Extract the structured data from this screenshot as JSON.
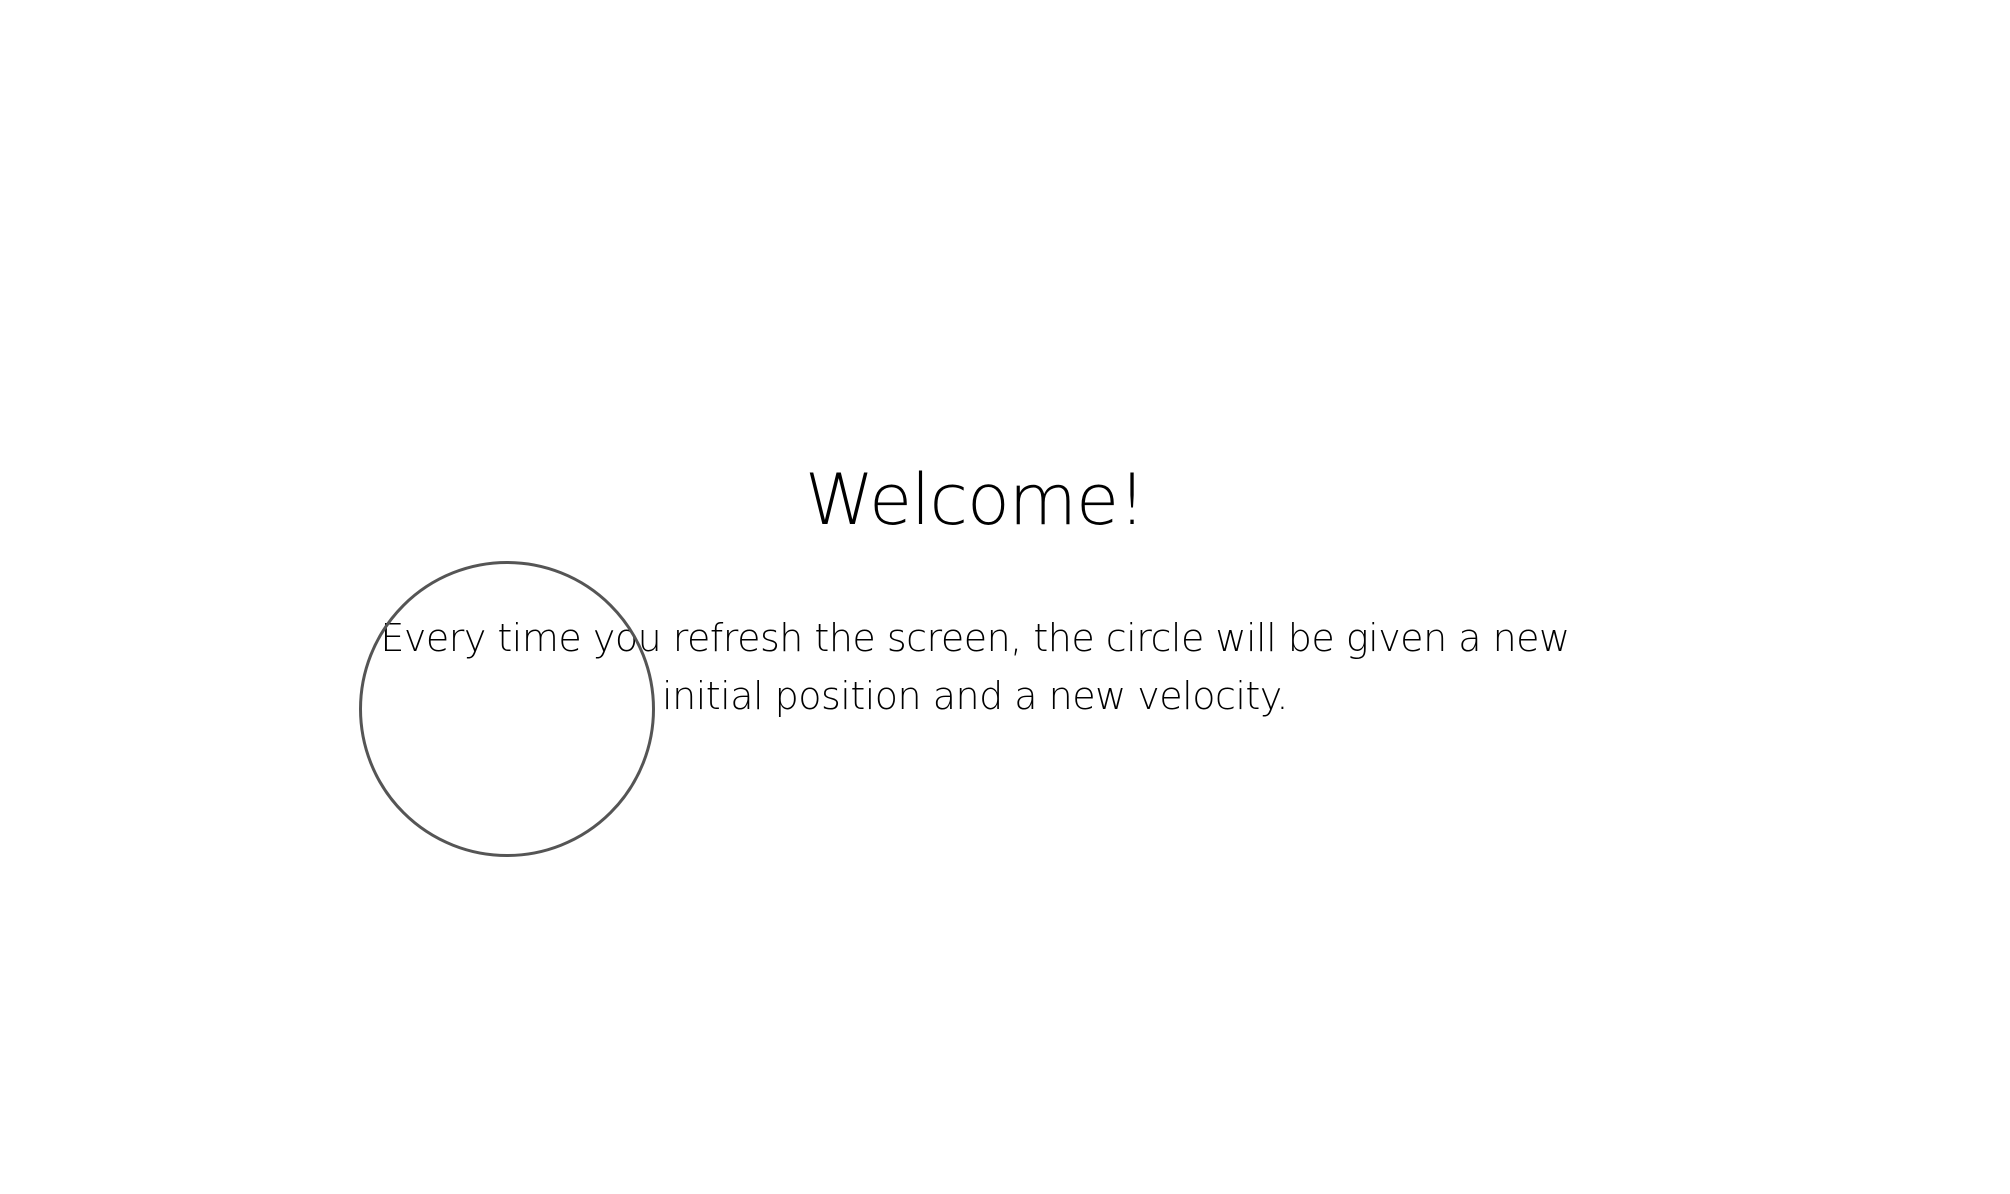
{
  "welcome": {
    "title": "Welcome!",
    "description": "Every time you refresh the screen, the circle will be given a new initial position and a new velocity."
  },
  "colors": {
    "background": "#ffffff",
    "text": "#000000",
    "circle_stroke": "#555555"
  }
}
